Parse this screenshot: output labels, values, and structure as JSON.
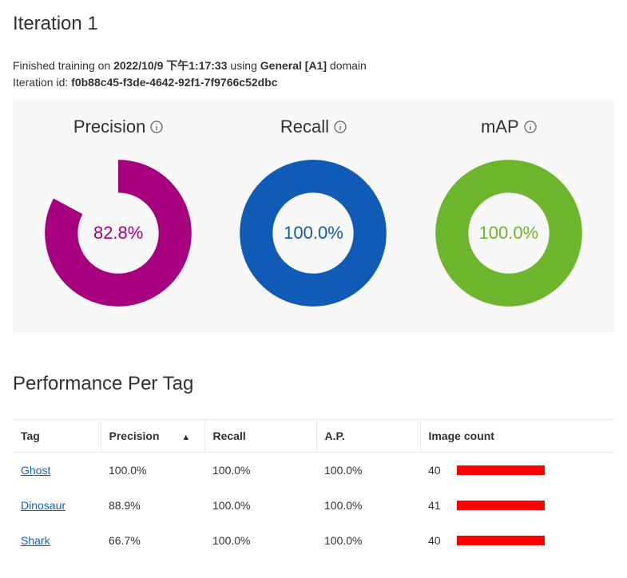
{
  "page_title": "Iteration 1",
  "training_line1_prefix": "Finished training on ",
  "training_datetime": "2022/10/9 下午1:17:33",
  "training_line1_mid": " using ",
  "training_domain": "General [A1]",
  "training_line1_suffix": " domain",
  "training_line2_prefix": "Iteration id: ",
  "iteration_id": "f0b88c45-f3de-4642-92f1-7f9766c52dbc",
  "metrics": {
    "precision": {
      "label": "Precision",
      "value": "82.8%",
      "percent": 82.8,
      "color": "#a6007f"
    },
    "recall": {
      "label": "Recall",
      "value": "100.0%",
      "percent": 100.0,
      "color": "#0f5bb5"
    },
    "map": {
      "label": "mAP",
      "value": "100.0%",
      "percent": 100.0,
      "color": "#6cb52c"
    }
  },
  "perf_section_title": "Performance Per Tag",
  "columns": {
    "tag": "Tag",
    "precision": "Precision",
    "recall": "Recall",
    "ap": "A.P.",
    "image_count": "Image count"
  },
  "rows": [
    {
      "tag": "Ghost",
      "precision": "100.0%",
      "recall": "100.0%",
      "ap": "100.0%",
      "count": "40"
    },
    {
      "tag": "Dinosaur",
      "precision": "88.9%",
      "recall": "100.0%",
      "ap": "100.0%",
      "count": "41"
    },
    {
      "tag": "Shark",
      "precision": "66.7%",
      "recall": "100.0%",
      "ap": "100.0%",
      "count": "40"
    }
  ],
  "chart_data": [
    {
      "type": "pie",
      "title": "Precision",
      "values": [
        82.8,
        17.2
      ],
      "categories": [
        "value",
        "remainder"
      ],
      "colors": [
        "#a6007f",
        "transparent"
      ]
    },
    {
      "type": "pie",
      "title": "Recall",
      "values": [
        100.0,
        0.0
      ],
      "categories": [
        "value",
        "remainder"
      ],
      "colors": [
        "#0f5bb5",
        "transparent"
      ]
    },
    {
      "type": "pie",
      "title": "mAP",
      "values": [
        100.0,
        0.0
      ],
      "categories": [
        "value",
        "remainder"
      ],
      "colors": [
        "#6cb52c",
        "transparent"
      ]
    },
    {
      "type": "table",
      "title": "Performance Per Tag",
      "columns": [
        "Tag",
        "Precision",
        "Recall",
        "A.P.",
        "Image count"
      ],
      "rows": [
        [
          "Ghost",
          100.0,
          100.0,
          100.0,
          40
        ],
        [
          "Dinosaur",
          88.9,
          100.0,
          100.0,
          41
        ],
        [
          "Shark",
          66.7,
          100.0,
          100.0,
          40
        ]
      ]
    }
  ]
}
